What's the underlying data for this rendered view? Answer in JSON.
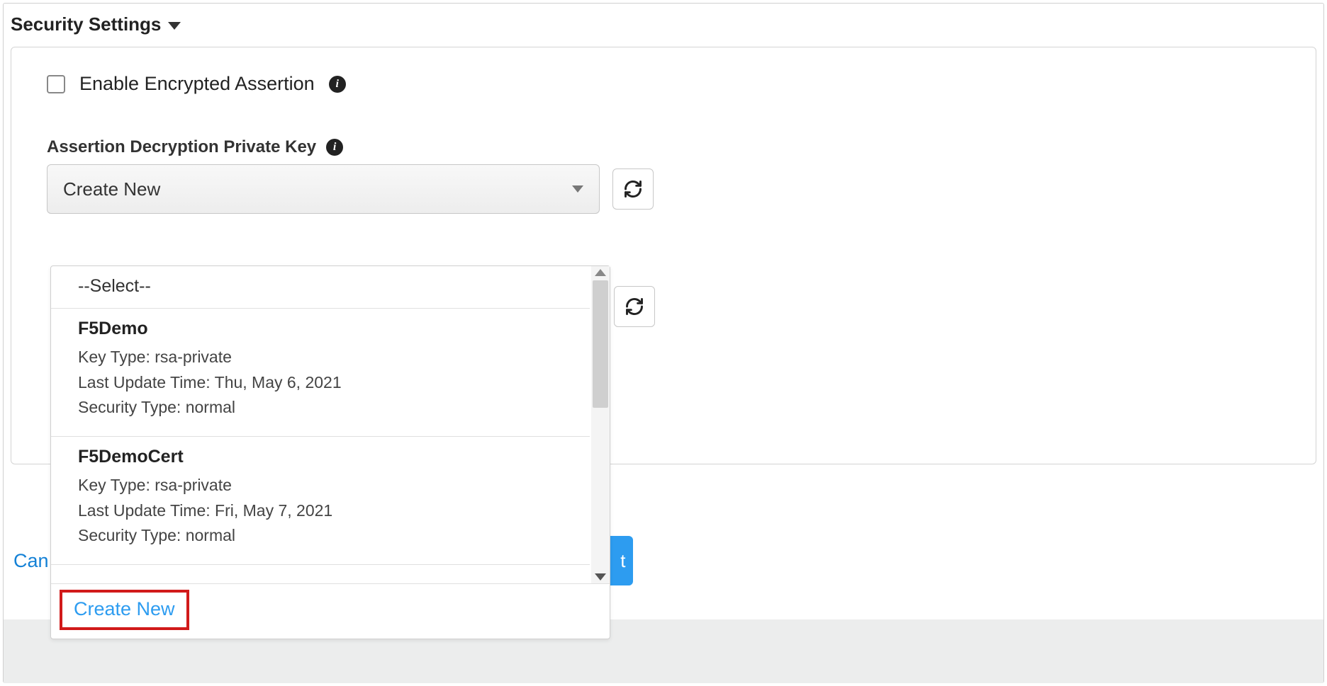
{
  "section": {
    "title": "Security Settings"
  },
  "checkbox": {
    "label": "Enable Encrypted Assertion"
  },
  "field": {
    "label": "Assertion Decryption Private Key",
    "selected": "Create New"
  },
  "dropdown": {
    "placeholder": "--Select--",
    "items": [
      {
        "name": "F5Demo",
        "key_type_label": "Key Type:",
        "key_type": "rsa-private",
        "last_update_label": "Last Update Time:",
        "last_update": "Thu, May 6, 2021",
        "security_type_label": "Security Type:",
        "security_type": "normal"
      },
      {
        "name": "F5DemoCert",
        "key_type_label": "Key Type:",
        "key_type": "rsa-private",
        "last_update_label": "Last Update Time:",
        "last_update": "Fri, May 7, 2021",
        "security_type_label": "Security Type:",
        "security_type": "normal"
      }
    ],
    "create_new": "Create New"
  },
  "buttons": {
    "cancel": "Can",
    "next_fragment": "t"
  }
}
